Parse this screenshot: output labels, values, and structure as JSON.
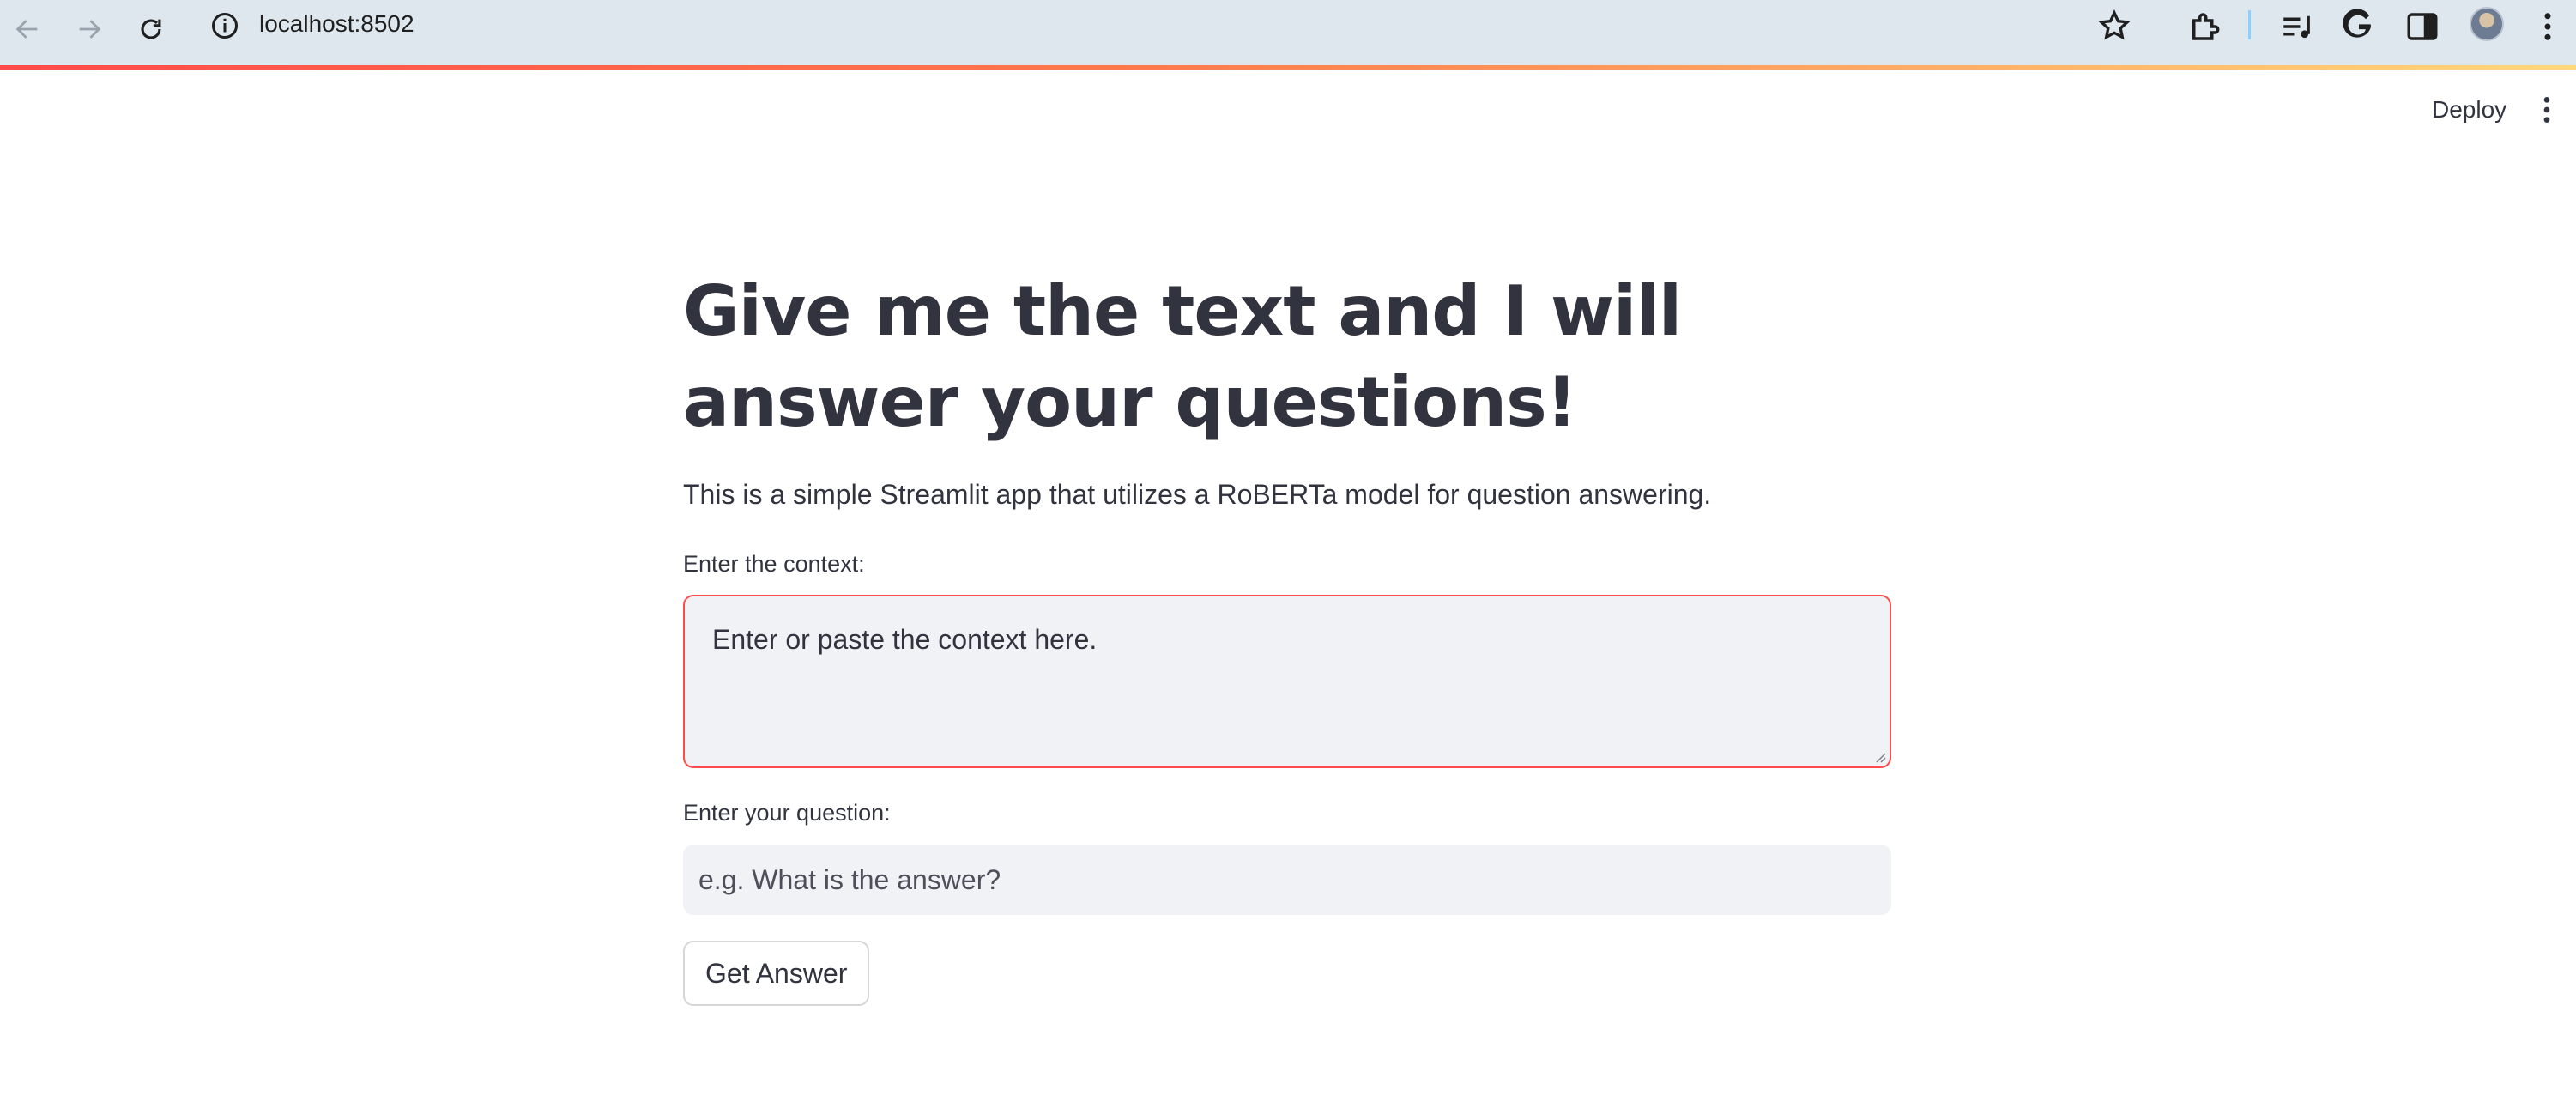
{
  "browser": {
    "url": "localhost:8502",
    "icons": [
      "back-icon",
      "forward-icon",
      "reload-icon",
      "site-info-icon",
      "bookmark-star-icon",
      "extensions-icon",
      "media-icon",
      "google-icon",
      "side-panel-icon",
      "profile-avatar",
      "browser-menu-icon"
    ]
  },
  "app_header": {
    "deploy_label": "Deploy",
    "menu_icon": "kebab-icon"
  },
  "main": {
    "title": "Give me the text and I will answer your questions!",
    "subtitle": "This is a simple Streamlit app that utilizes a RoBERTa model for question answering.",
    "context": {
      "label": "Enter the context:",
      "placeholder": "Enter or paste the context here."
    },
    "question": {
      "label": "Enter your question:",
      "placeholder": "e.g. What is the answer?"
    },
    "submit_label": "Get Answer"
  },
  "colors": {
    "accent": "#ff4b4b",
    "text": "#31333f",
    "input_bg": "#f0f2f6",
    "browser_bar": "#dfe7ee"
  }
}
